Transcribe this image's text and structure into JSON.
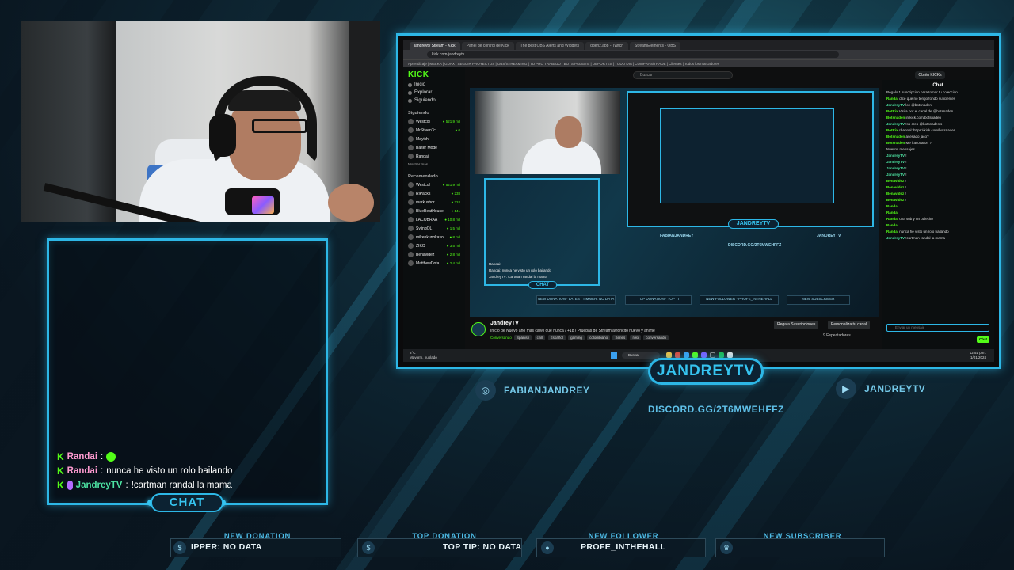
{
  "colors": {
    "accent": "#2db7e6",
    "kick_green": "#53fc18",
    "background": "#0a1620"
  },
  "overlay": {
    "streamer_title": "JANDREYTV",
    "chat_tab": "CHAT",
    "instagram": "FABIANJANDREY",
    "youtube": "JANDREYTV",
    "discord": "DISCORD.GG/2T6MWEHFFZ",
    "chat": [
      {
        "user": "Randai",
        "sep": ":",
        "text": "",
        "emote": true
      },
      {
        "user": "Randai",
        "sep": ":",
        "text": "nunca he visto un rolo bailando"
      },
      {
        "user": "JandreyTV",
        "sep": ":",
        "text": "!cartman randal la mama"
      }
    ],
    "bars": [
      {
        "label": "NEW DONATION",
        "value": "IPPER: NO DATA",
        "icon": "dollar-icon"
      },
      {
        "label": "TOP DONATION",
        "value": "TOP TIP: NO DATA",
        "icon": "money-bag-icon"
      },
      {
        "label": "NEW FOLLOWER",
        "value": "PROFE_INTHEHALL",
        "icon": "user-icon"
      },
      {
        "label": "NEW SUBSCRIBER",
        "value": "",
        "icon": "crown-icon"
      }
    ]
  },
  "browser": {
    "tabs": [
      "jandreytv Stream - Kick",
      "Panel de control de Kick",
      "The best OBS Alerts and Widgets",
      "qgenz.app - Twitch",
      "StreamElements - OBS"
    ],
    "url": "kick.com/jandreytv",
    "bookmarks": "Aprendizaje | MELKA | GDAX | SEGUIR PROYECTOS | OBS/STREAMING | TU PRO TRABAJO | BOTS/PAGE/TE | DEPORTES | TODO DIA | COMPRAS/TRADE | Clientes | Todos los marcadores"
  },
  "kick": {
    "logo": "KICK",
    "search_placeholder": "Buscar",
    "login": "Obtén KICKs",
    "nav": [
      "Inicio",
      "Explorar",
      "Siguiendo"
    ],
    "following_head": "Siguiendo",
    "following": [
      {
        "name": "Westcol",
        "viewers": "● 521,9 mil"
      },
      {
        "name": "MrStivenTc",
        "viewers": "● 0"
      },
      {
        "name": "Mayichi",
        "viewers": ""
      },
      {
        "name": "Baiter Mode",
        "viewers": ""
      },
      {
        "name": "Randai",
        "viewers": ""
      }
    ],
    "show_more": "Mostrar más",
    "recommended_head": "Recomendado",
    "recommended": [
      {
        "name": "Westcol",
        "viewers": "● 521,9 mil"
      },
      {
        "name": "RiPacks",
        "viewers": "● 238"
      },
      {
        "name": "markusbdr",
        "viewers": "● 224"
      },
      {
        "name": "BlueBeatHouse",
        "viewers": "● 141"
      },
      {
        "name": "LACOBRAA",
        "viewers": "● 10,8 mil"
      },
      {
        "name": "SylingOL",
        "viewers": "● 1,5 mil"
      },
      {
        "name": "mikenkunokaso",
        "viewers": "● 8 mil"
      },
      {
        "name": "ZIKO",
        "viewers": "● 3,5 mil"
      },
      {
        "name": "Benavidez",
        "viewers": "● 2,8 mil"
      },
      {
        "name": "MatthewDota",
        "viewers": "● 2,4 mil"
      }
    ],
    "stream": {
      "name": "JandreyTV",
      "title": "Inicio de Nuevo año mas calvo que nunca / +18 / Pruebas de Stream avioncito nuevo y anime",
      "category": "Conversando",
      "tags": [
        "Spanish",
        "chill",
        "Español",
        "gaming",
        "colombiano",
        "Series",
        "rolo",
        "conversando"
      ],
      "gift_button": "Regala Suscripciones",
      "customize_button": "Personaliza tu canal",
      "viewers": "9 Espectadores"
    },
    "mini": {
      "chat_tab": "CHAT",
      "title": "JANDREYTV",
      "instagram": "FABIANJANDREY",
      "youtube": "JANDREYTV",
      "discord": "DISCORD.GG/2T6MWEHFFZ",
      "chat": [
        "Randai:",
        "Randai: nunca he visto un rolo bailando",
        "JandreyTV: !cartman randal la mama"
      ],
      "bars": [
        "NEW DONATION · LATEST TIMMER: NO DATA",
        "TOP DONATION · TOP TI",
        "NEW FOLLOWER · PROFE_INTHEHALL",
        "NEW SUBSCRIBER"
      ]
    },
    "chat": {
      "title": "Chat",
      "lines": [
        {
          "user": "",
          "text": "Regalo 1 suscripción para tomar tu colección"
        },
        {
          "user": "Randai",
          "text": "dice que no tengo fondo suficientes"
        },
        {
          "user": "JandreyTV",
          "text": "loc @botsnaden"
        },
        {
          "user": "BotRix",
          "text": "Visita por el canal de @botsnaden"
        },
        {
          "user": "Botsnaden",
          "text": "in kick.com/botsnaden"
        },
        {
          "user": "JandreyTV",
          "text": "!so creo @botsnaden's"
        },
        {
          "user": "BotRix",
          "text": "channel: https://kick.com/botsnaden"
        },
        {
          "user": "Botsnaden",
          "text": "asesado jaco?"
        },
        {
          "user": "Botsnaden",
          "text": "Me iracocaron ?"
        },
        {
          "user": "",
          "text": "Nuevos mensajes"
        },
        {
          "user": "JandreyTV",
          "text": "!"
        },
        {
          "user": "JandreyTV",
          "text": "!"
        },
        {
          "user": "JandreyTV",
          "text": "!"
        },
        {
          "user": "JandreyTV",
          "text": "!"
        },
        {
          "user": "Benavidez",
          "text": "!"
        },
        {
          "user": "Benavidez",
          "text": "!"
        },
        {
          "user": "Benavidez",
          "text": "!"
        },
        {
          "user": "Benavidez",
          "text": "!"
        },
        {
          "user": "Randai",
          "text": ""
        },
        {
          "user": "Randai",
          "text": ""
        },
        {
          "user": "Randai",
          "text": "una sub y un balecito"
        },
        {
          "user": "Randai",
          "text": ""
        },
        {
          "user": "Randai",
          "text": "nunca he visto un rolo bailando"
        },
        {
          "user": "JandreyTV",
          "text": "!cartman randal la mama"
        }
      ],
      "input_placeholder": "Enviar un mensaje",
      "send": "Chat"
    },
    "taskbar": {
      "weather": "8°C",
      "weather_desc": "Mayorm. nublado",
      "search": "Buscar",
      "time": "12:51 p.m.",
      "date": "1/01/2024"
    }
  }
}
